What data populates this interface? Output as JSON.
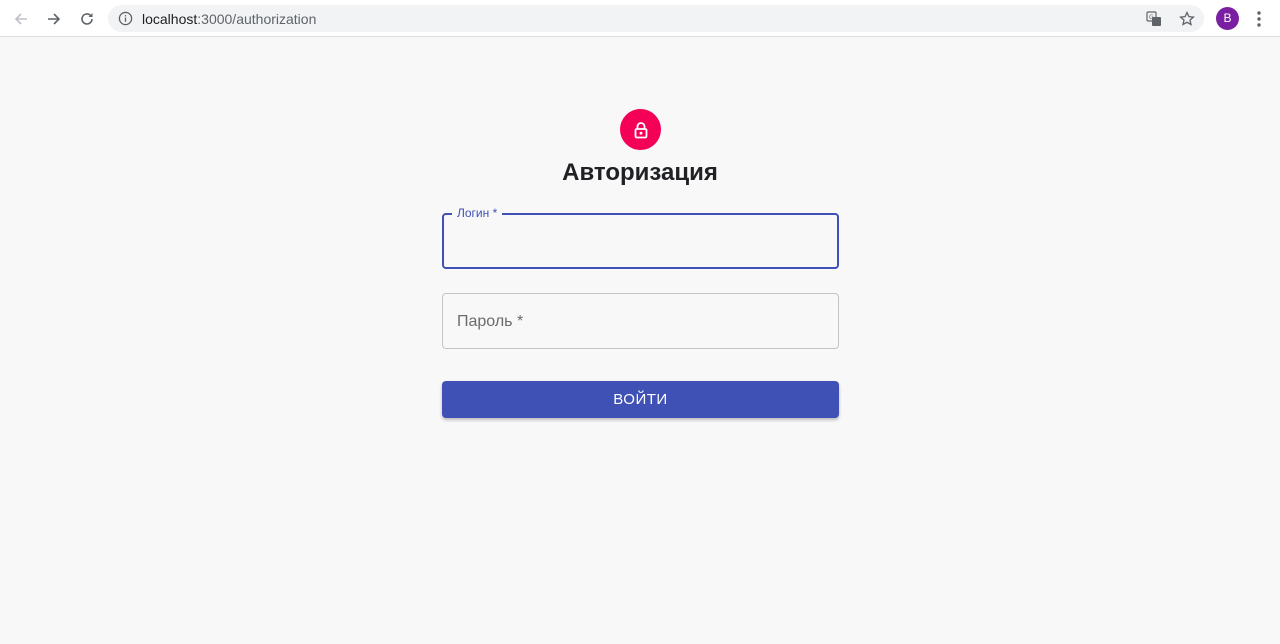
{
  "browser": {
    "url_host": "localhost",
    "url_path": ":3000/authorization",
    "profile_initial": "B",
    "profile_color": "#7b1fa2"
  },
  "icons": {
    "back": "arrow-left-icon",
    "forward": "arrow-right-icon",
    "reload": "reload-icon",
    "site_info": "info-icon",
    "translate": "translate-icon",
    "bookmark": "star-icon",
    "menu": "kebab-menu-icon",
    "avatar_badge": "lock-icon"
  },
  "page": {
    "title": "Авторизация",
    "lock_color": "#f50057",
    "accent_color": "#3f51b5"
  },
  "form": {
    "login_label": "Логин *",
    "login_value": "",
    "password_label": "Пароль *",
    "password_value": "",
    "submit_label": "ВОЙТИ"
  }
}
